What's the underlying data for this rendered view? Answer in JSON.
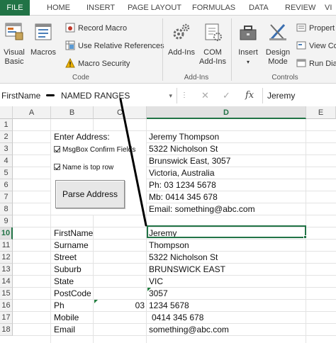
{
  "tabs": [
    "FILE",
    "HOME",
    "INSERT",
    "PAGE LAYOUT",
    "FORMULAS",
    "DATA",
    "REVIEW",
    "VI"
  ],
  "ribbon": {
    "visual_basic": "Visual Basic",
    "macros": "Macros",
    "record_macro": "Record Macro",
    "relative_refs": "Use Relative References",
    "macro_security": "Macro Security",
    "group_code": "Code",
    "addins": "Add-Ins",
    "com_addins": "COM Add-Ins",
    "group_addins": "Add-Ins",
    "insert": "Insert",
    "design_mode": "Design Mode",
    "properties": "Propert",
    "view_code": "View Co",
    "run_dialog": "Run Dia",
    "group_controls": "Controls"
  },
  "formula_bar": {
    "name_box": "FirstName",
    "annotation": "NAMED RANGES",
    "fx": "fx",
    "value": "Jeremy"
  },
  "columns": [
    "A",
    "B",
    "C",
    "D",
    "E"
  ],
  "active_column": "D",
  "rows": [
    "1",
    "2",
    "3",
    "4",
    "5",
    "6",
    "7",
    "8",
    "9",
    "10",
    "11",
    "12",
    "13",
    "14",
    "15",
    "16",
    "17",
    "18"
  ],
  "active_row": "10",
  "form": {
    "enter_address": "Enter Address:",
    "msgbox_confirm": "MsgBox Confirm Fields",
    "name_top_row": "Name is top row",
    "parse_button": "Parse Address"
  },
  "address_block": [
    "Jeremy Thompson",
    "5322 Nicholson St",
    "Brunswick East, 3057",
    "Victoria, Australia",
    "Ph: 03 1234 5678",
    "Mb: 0414 345 678",
    "Email: something@abc.com"
  ],
  "fields": [
    {
      "name": "FirstName",
      "value": "Jeremy"
    },
    {
      "name": "Surname",
      "value": "Thompson"
    },
    {
      "name": "Street",
      "value": "5322 Nicholson St"
    },
    {
      "name": "Suburb",
      "value": "BRUNSWICK EAST"
    },
    {
      "name": "State",
      "value": "VIC"
    },
    {
      "name": "PostCode",
      "value": "3057"
    },
    {
      "name": "Ph",
      "value": "1234 5678",
      "c_value": "03"
    },
    {
      "name": "Mobile",
      "value": "0414 345 678"
    },
    {
      "name": "Email",
      "value": "something@abc.com"
    }
  ],
  "colors": {
    "accent": "#217346",
    "annotation_line": "#000000"
  },
  "icons": {
    "visual_basic": "visual-basic-icon",
    "macros": "macros-icon",
    "record": "record-macro-icon",
    "relative": "relative-references-icon",
    "security": "warning-icon",
    "addins": "gears-icon",
    "com": "com-addins-icon",
    "insert": "toolbox-icon",
    "design": "design-mode-icon"
  }
}
